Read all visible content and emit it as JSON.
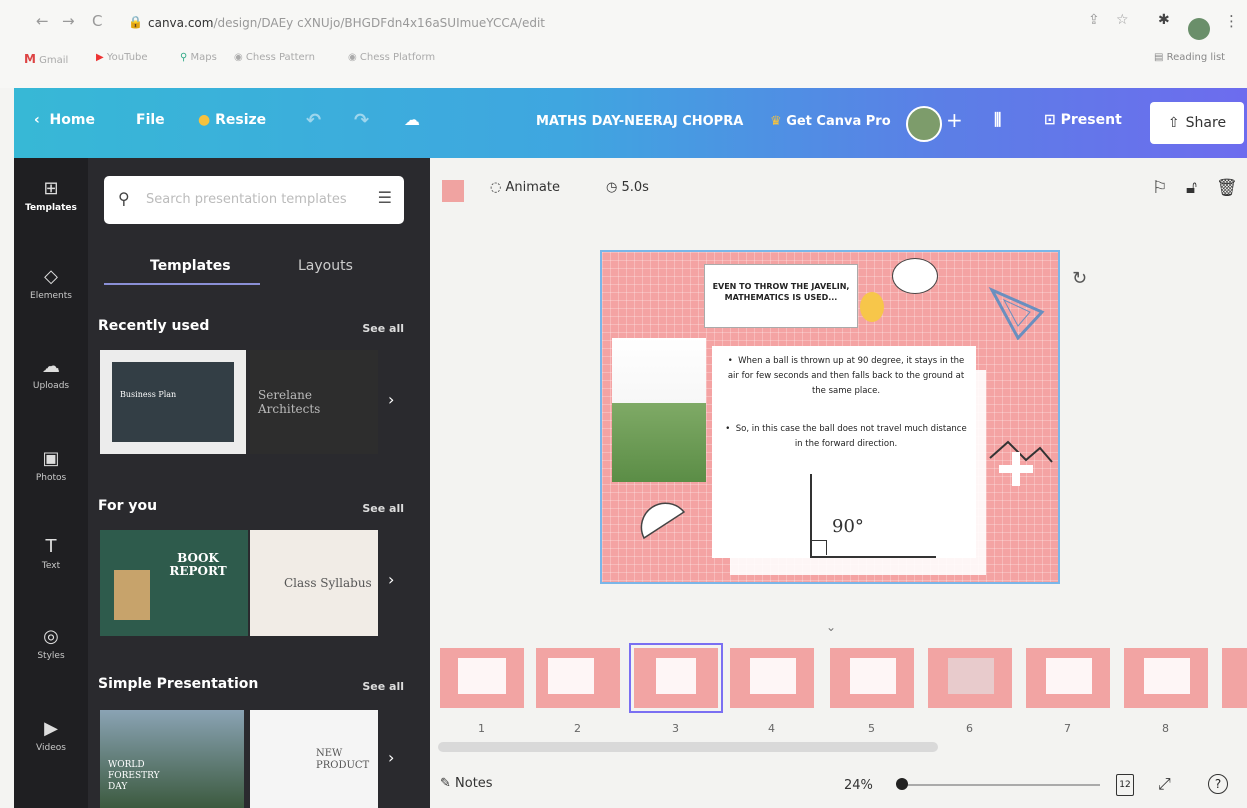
{
  "browser": {
    "url_domain": "canva.com",
    "url_path": "/design/DAEy cXNUjo/BHGDFdn4x16aSUImueYCCA/edit",
    "bookmarks": [
      "Gmail",
      "YouTube",
      "Maps",
      "Chess Pattern",
      "Chess Platform"
    ],
    "reading_list": "Reading list"
  },
  "topbar": {
    "home": "Home",
    "file": "File",
    "resize": "Resize",
    "title": "MATHS DAY-NEERAJ CHOPRA",
    "get_pro": "Get Canva Pro",
    "present": "Present",
    "share": "Share"
  },
  "rail": [
    "Templates",
    "Elements",
    "Uploads",
    "Photos",
    "Text",
    "Styles",
    "Videos"
  ],
  "panel": {
    "search_placeholder": "Search presentation templates",
    "tabs": [
      "Templates",
      "Layouts"
    ],
    "sections": [
      "Recently used",
      "For you",
      "Simple Presentation"
    ],
    "see_all": "See all",
    "thumbs": {
      "business_plan": "Business Plan",
      "serelane": "Serelane Architects",
      "book_report": "BOOK REPORT",
      "class_syllabus": "Class Syllabus",
      "world_forestry": "WORLD FORESTRY DAY",
      "new_product": "NEW PRODUCT"
    }
  },
  "editor_toolbar": {
    "animate": "Animate",
    "duration": "5.0s"
  },
  "slide": {
    "title": "EVEN TO THROW THE JAVELIN, MATHEMATICS IS USED...",
    "bullet1": "When a ball is thrown up at 90 degree, it stays in the air for few seconds and then falls back to the ground at the same place.",
    "bullet2": "So, in this case the ball does not travel much distance in the forward direction.",
    "angle": "90°"
  },
  "filmstrip": {
    "pages": [
      "1",
      "2",
      "3",
      "4",
      "5",
      "6",
      "7",
      "8"
    ],
    "selected": "3"
  },
  "footer": {
    "notes": "Notes",
    "zoom": "24%",
    "page_count": "12",
    "help": "?"
  }
}
